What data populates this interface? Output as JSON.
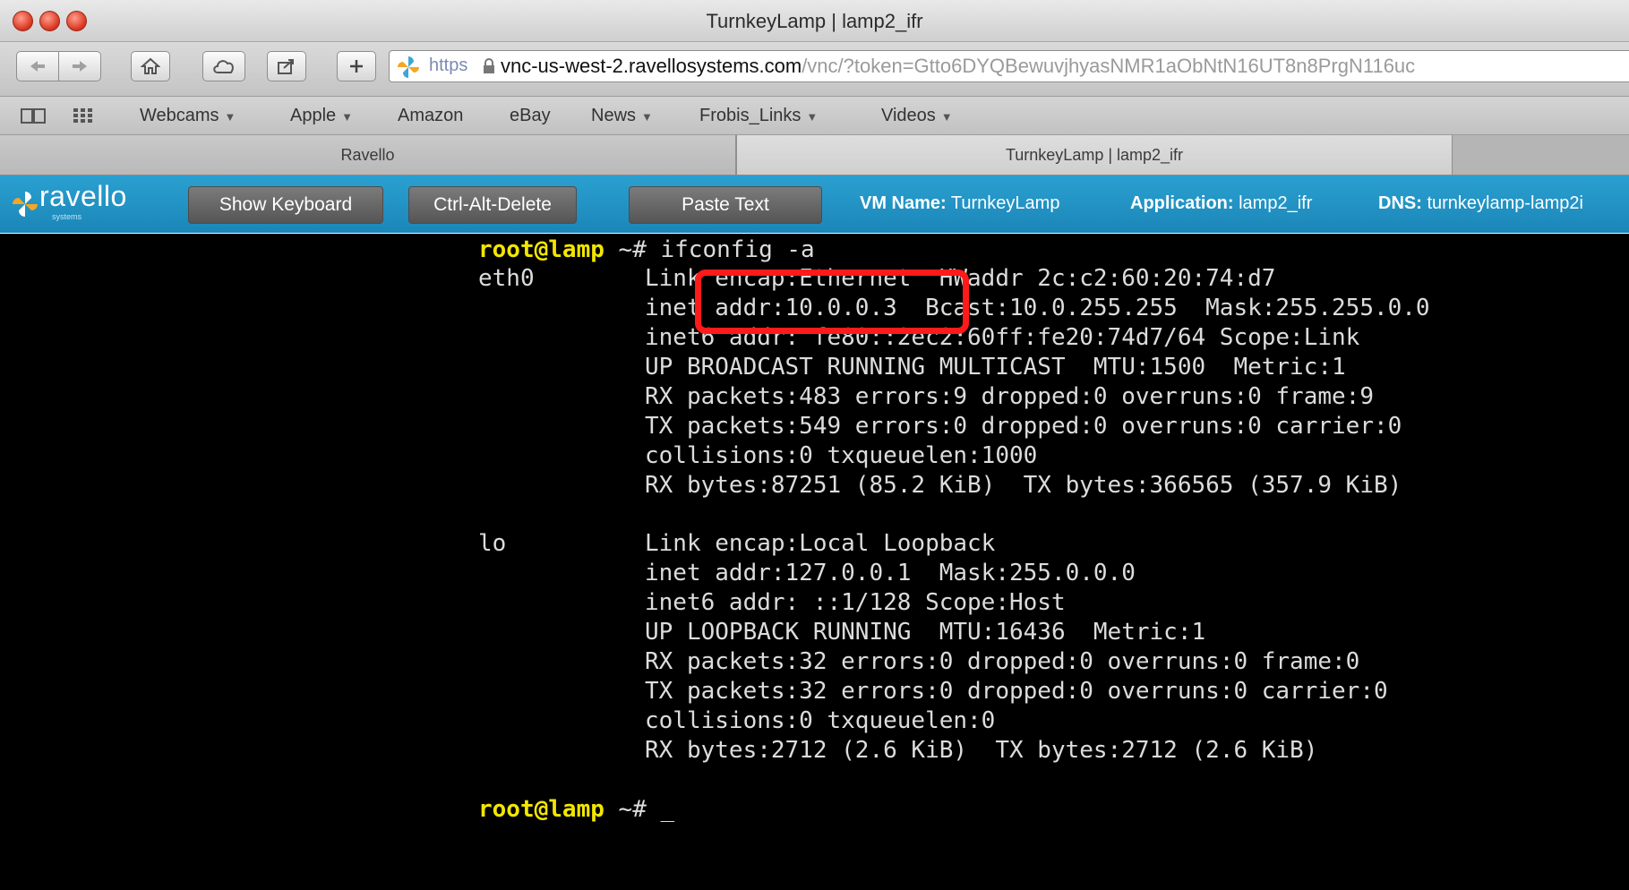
{
  "window": {
    "title": "TurnkeyLamp | lamp2_ifr"
  },
  "toolbar": {
    "url_scheme": "https",
    "url_host": "vnc-us-west-2.ravellosystems.com",
    "url_path": "/vnc/?token=Gtto6DYQBewuvjhyasNMR1aObNtN16UT8n8PrgN116uc"
  },
  "bookmarks": [
    {
      "label": "Webcams",
      "menu": true
    },
    {
      "label": "Apple",
      "menu": true
    },
    {
      "label": "Amazon",
      "menu": false
    },
    {
      "label": "eBay",
      "menu": false
    },
    {
      "label": "News",
      "menu": true
    },
    {
      "label": "Frobis_Links",
      "menu": true
    },
    {
      "label": "Videos",
      "menu": true
    }
  ],
  "tabs": [
    {
      "label": "Ravello"
    },
    {
      "label": "TurnkeyLamp | lamp2_ifr"
    }
  ],
  "ravello": {
    "logo_text": "ravello",
    "logo_sub": "systems",
    "show_keyboard": "Show Keyboard",
    "ctrl_alt_delete": "Ctrl-Alt-Delete",
    "paste_text": "Paste Text",
    "vm_name_label": "VM Name:",
    "vm_name_value": "TurnkeyLamp",
    "application_label": "Application:",
    "application_value": "lamp2_ifr",
    "dns_label": "DNS:",
    "dns_value": "turnkeylamp-lamp2i"
  },
  "terminal": {
    "prompt": "root@lamp",
    "command_line": " ~# ifconfig -a",
    "end_prompt_suffix": " ~# _",
    "eth0_label": "eth0",
    "lo_label": "lo",
    "eth0_lines": [
      "Link encap:Ethernet  HWaddr 2c:c2:60:20:74:d7",
      "inet addr:10.0.0.3  Bcast:10.0.255.255  Mask:255.255.0.0",
      "inet6 addr: fe80::2ec2:60ff:fe20:74d7/64 Scope:Link",
      "UP BROADCAST RUNNING MULTICAST  MTU:1500  Metric:1",
      "RX packets:483 errors:9 dropped:0 overruns:0 frame:9",
      "TX packets:549 errors:0 dropped:0 overruns:0 carrier:0",
      "collisions:0 txqueuelen:1000",
      "RX bytes:87251 (85.2 KiB)  TX bytes:366565 (357.9 KiB)"
    ],
    "lo_lines": [
      "Link encap:Local Loopback",
      "inet addr:127.0.0.1  Mask:255.0.0.0",
      "inet6 addr: ::1/128 Scope:Host",
      "UP LOOPBACK RUNNING  MTU:16436  Metric:1",
      "RX packets:32 errors:0 dropped:0 overruns:0 frame:0",
      "TX packets:32 errors:0 dropped:0 overruns:0 carrier:0",
      "collisions:0 txqueuelen:0",
      "RX bytes:2712 (2.6 KiB)  TX bytes:2712 (2.6 KiB)"
    ],
    "highlight_color": "#ff1a1a",
    "prompt_color": "#f2e600"
  },
  "icons": {
    "back": "back-arrow-icon",
    "forward": "forward-arrow-icon",
    "home": "home-icon",
    "cloud": "icloud-icon",
    "share": "share-icon",
    "add": "plus-icon",
    "site": "ravello-site-icon",
    "lock": "lock-icon",
    "reading_list": "book-icon",
    "top_sites": "grid-icon"
  }
}
